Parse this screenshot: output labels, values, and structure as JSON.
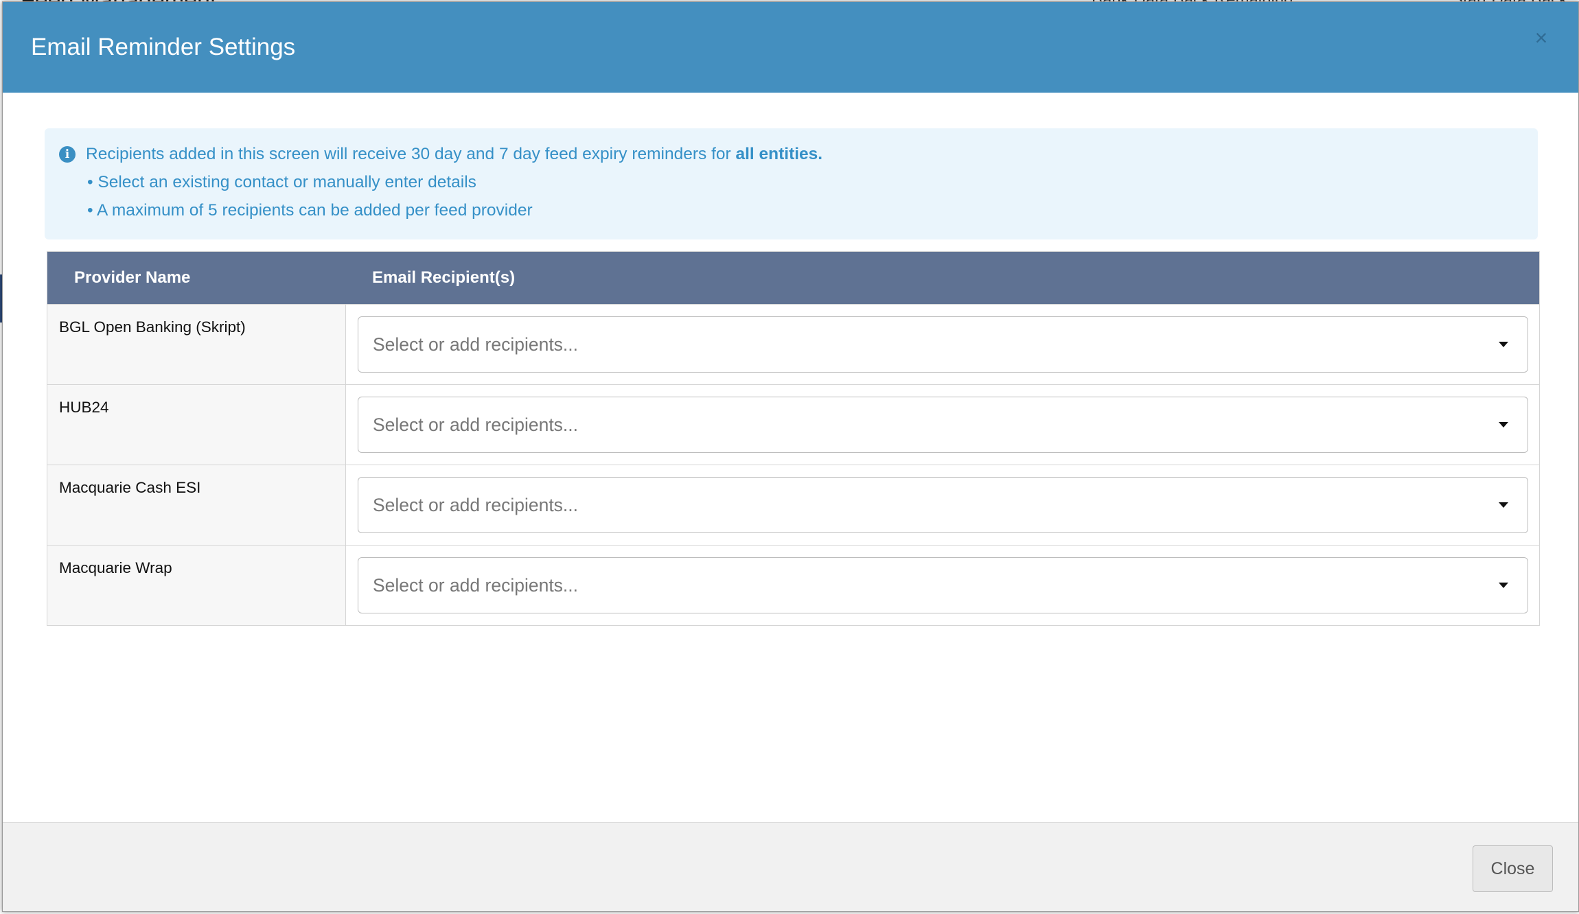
{
  "background": {
    "page_title": "Feed Management",
    "right_text_1": "Bank Data Back Remaining",
    "right_text_2": "Start Data Back"
  },
  "modal": {
    "title": "Email Reminder Settings",
    "close_icon": "close-icon"
  },
  "info": {
    "icon": "info-circle-icon",
    "line1_prefix": "Recipients added in this screen will receive 30 day and 7 day feed expiry reminders for ",
    "line1_bold": "all entities.",
    "line2": "• Select an existing contact or manually enter details",
    "line3": "• A maximum of 5 recipients can be added per feed provider"
  },
  "table": {
    "headers": {
      "provider": "Provider Name",
      "email": "Email Recipient(s)"
    },
    "rows": [
      {
        "provider": "BGL Open Banking (Skript)",
        "placeholder": "Select or add recipients..."
      },
      {
        "provider": "HUB24",
        "placeholder": "Select or add recipients..."
      },
      {
        "provider": "Macquarie Cash ESI",
        "placeholder": "Select or add recipients..."
      },
      {
        "provider": "Macquarie Wrap",
        "placeholder": "Select or add recipients..."
      }
    ]
  },
  "footer": {
    "close_label": "Close"
  },
  "colors": {
    "header_bg": "#448fbf",
    "table_header_bg": "#5f7293",
    "info_bg": "#eaf5fc",
    "info_text": "#3590c7"
  }
}
